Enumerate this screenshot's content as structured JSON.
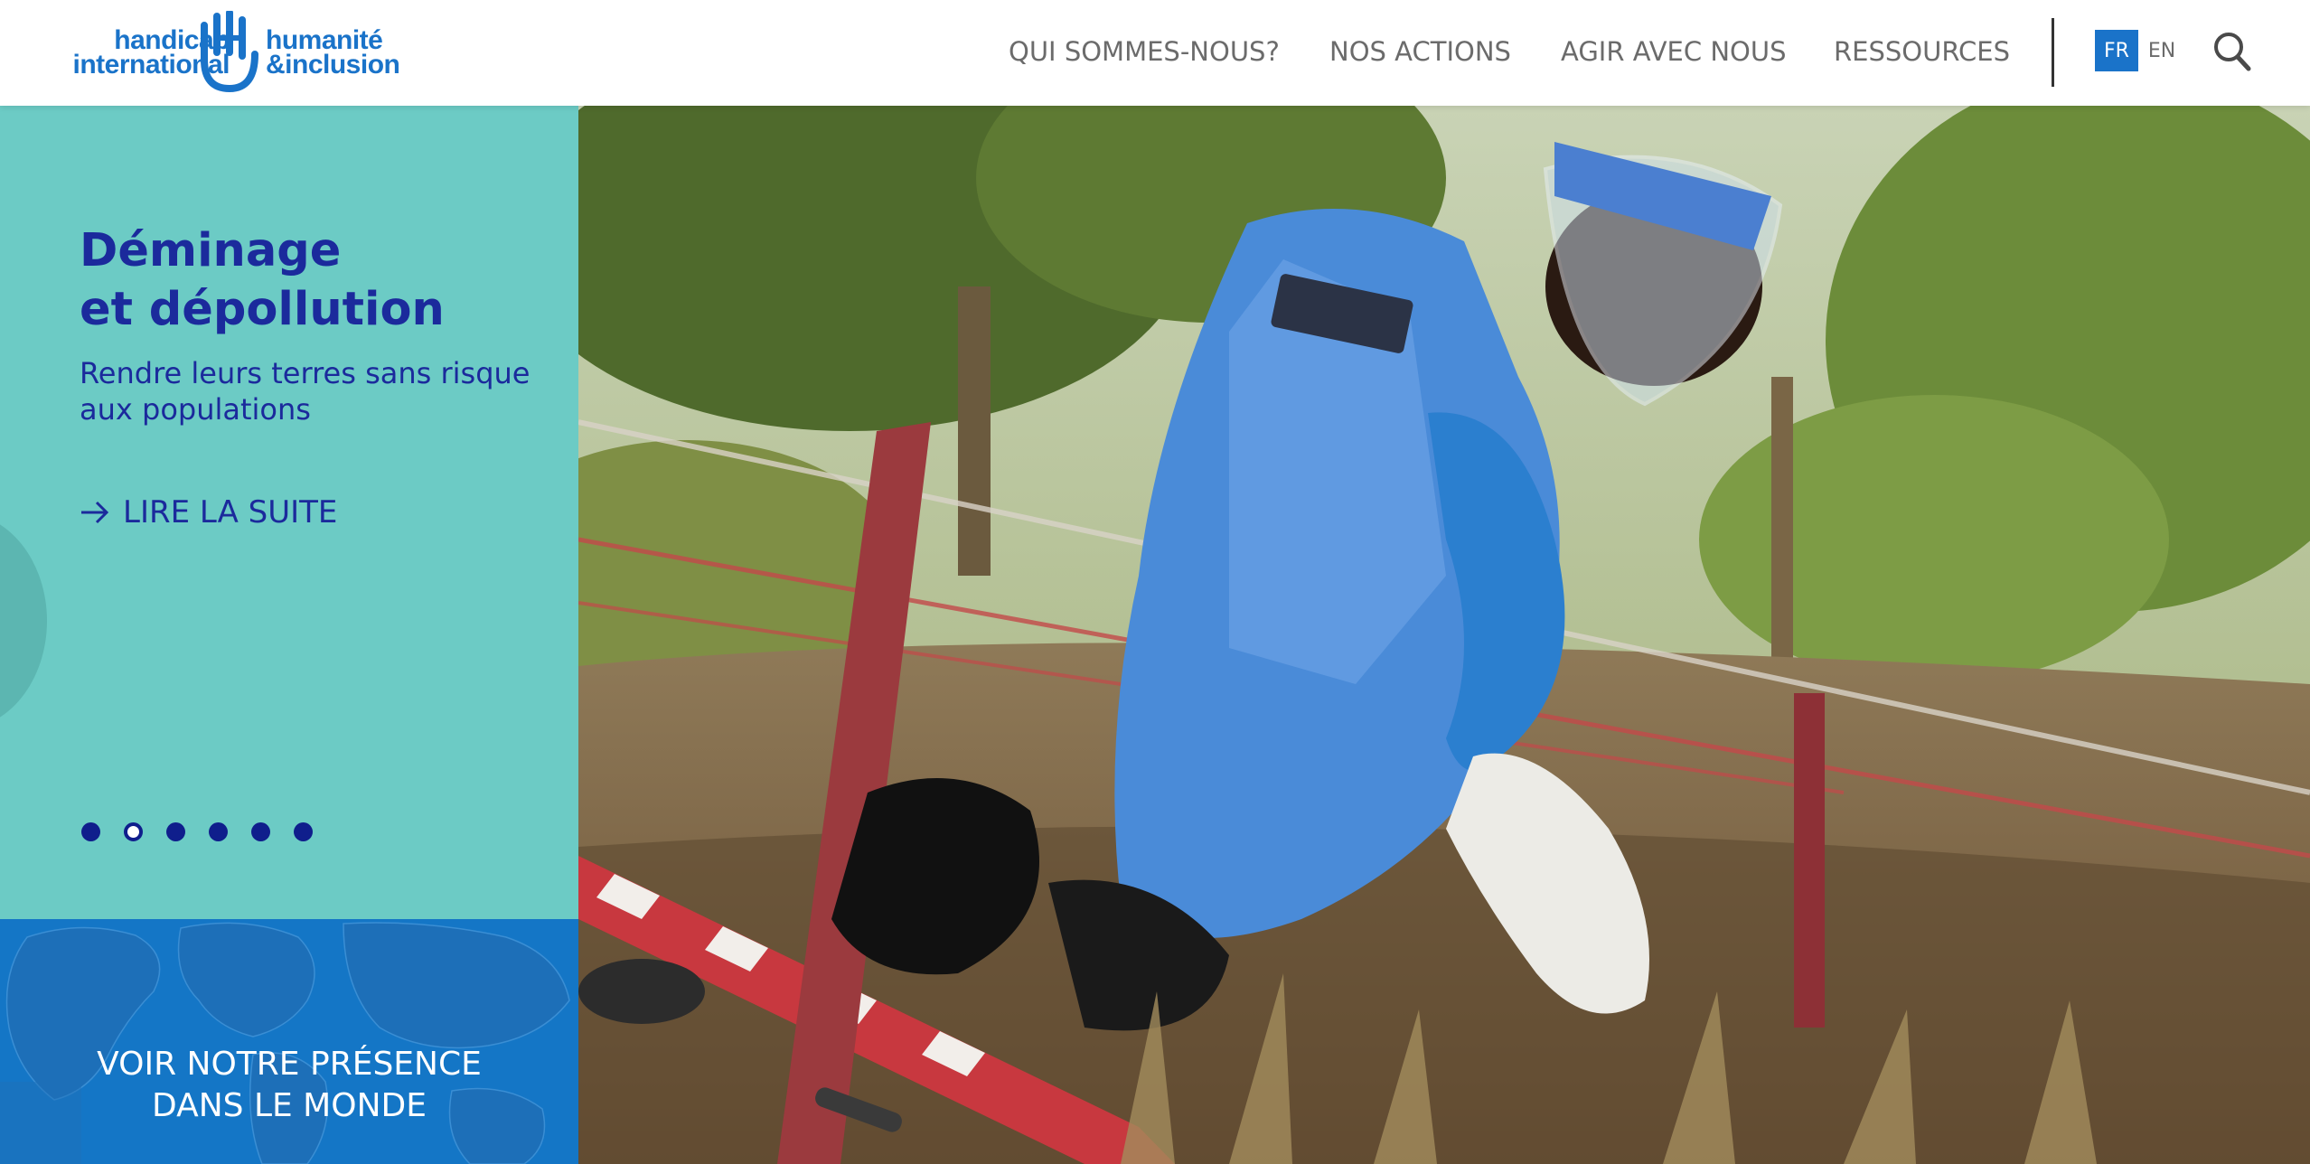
{
  "header": {
    "logo": {
      "left_line1": "handicap",
      "left_line2": "international",
      "right_line1": "humanité",
      "right_line2": "&inclusion"
    },
    "nav": [
      {
        "label": "QUI SOMMES-NOUS?"
      },
      {
        "label": "NOS ACTIONS"
      },
      {
        "label": "AGIR AVEC NOUS"
      },
      {
        "label": "RESSOURCES"
      }
    ],
    "lang_active": "FR",
    "lang_other": "EN",
    "search_icon": "search-icon"
  },
  "slide": {
    "title_line1": "Déminage",
    "title_line2": "et dépollution",
    "subtitle_line1": "Rendre leurs terres sans risque",
    "subtitle_line2": "aux populations",
    "cta": "LIRE LA SUITE",
    "dots_total": 6,
    "active_dot": 2
  },
  "map_cta": {
    "line1": "VOIR NOTRE PRÉSENCE",
    "line2": "DANS LE MONDE"
  },
  "colors": {
    "brand_blue": "#1a73c9",
    "teal_panel": "#6ccbc5",
    "navy_text": "#1b2a9c",
    "map_blue": "#1476c6"
  }
}
